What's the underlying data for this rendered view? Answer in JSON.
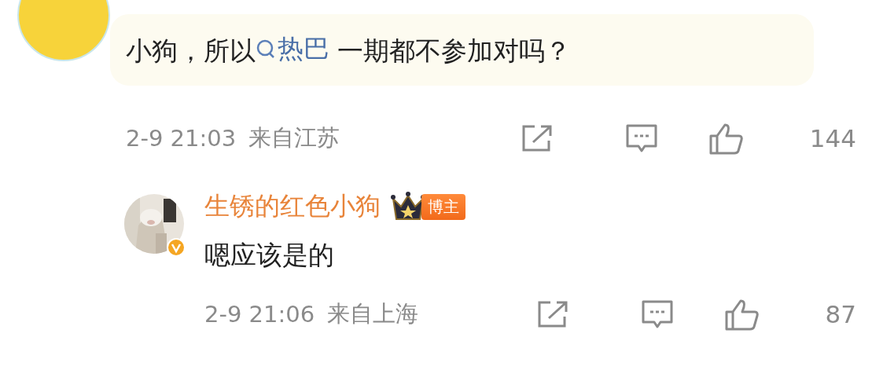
{
  "comment": {
    "avatar": {
      "kind": "plain"
    },
    "text": [
      {
        "kind": "text",
        "text": "小狗，所以"
      },
      {
        "kind": "topic",
        "text": "热巴"
      },
      {
        "kind": "text",
        "text": " 一期都不参加对吗？"
      }
    ],
    "time": "2-9 21:03",
    "location": "来自江苏",
    "likes": "144",
    "reply": {
      "name": "生锈的红色小狗",
      "badge": "博主",
      "text": "嗯应该是的",
      "time": "2-9 21:06",
      "location": "来自上海",
      "likes": "87"
    }
  }
}
